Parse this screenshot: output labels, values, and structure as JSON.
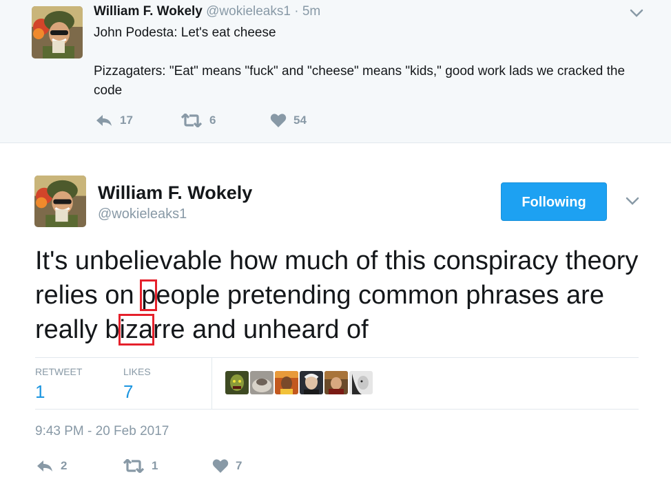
{
  "reply_tweet": {
    "author_name": "William F. Wokely",
    "handle": "@wokieleaks1",
    "separator": "·",
    "time": "5m",
    "lines": [
      "John Podesta: Let's eat cheese",
      "Pizzagaters: \"Eat\" means \"fuck\" and \"cheese\" means \"kids,\" good work lads we cracked the code"
    ],
    "replies": "17",
    "retweets": "6",
    "likes": "54",
    "avatar_icon": "soldier-avatar-icon"
  },
  "main_tweet": {
    "author_name": "William F. Wokely",
    "handle": "@wokieleaks1",
    "follow_label": "Following",
    "text": {
      "part1": "It's unbelievable how much of this conspiracy theory relies on ",
      "hl1": "p",
      "part2": "eople pretending common phrases are really b",
      "hl2": "iza",
      "part3": "rre and unheard of"
    },
    "highlight_color": "#e5202b",
    "stats": {
      "retweet_label": "RETWEET",
      "retweet_count": "1",
      "likes_label": "LIKES",
      "likes_count": "7"
    },
    "likers_count_shown": 6,
    "timestamp": "9:43 PM - 20 Feb 2017",
    "replies": "2",
    "retweets": "1",
    "likes": "7"
  },
  "colors": {
    "accent": "#1da1f2",
    "link_blue": "#1b95e0",
    "muted": "#8899a6",
    "text": "#14171a",
    "reply_bg": "#f5f8fa"
  }
}
